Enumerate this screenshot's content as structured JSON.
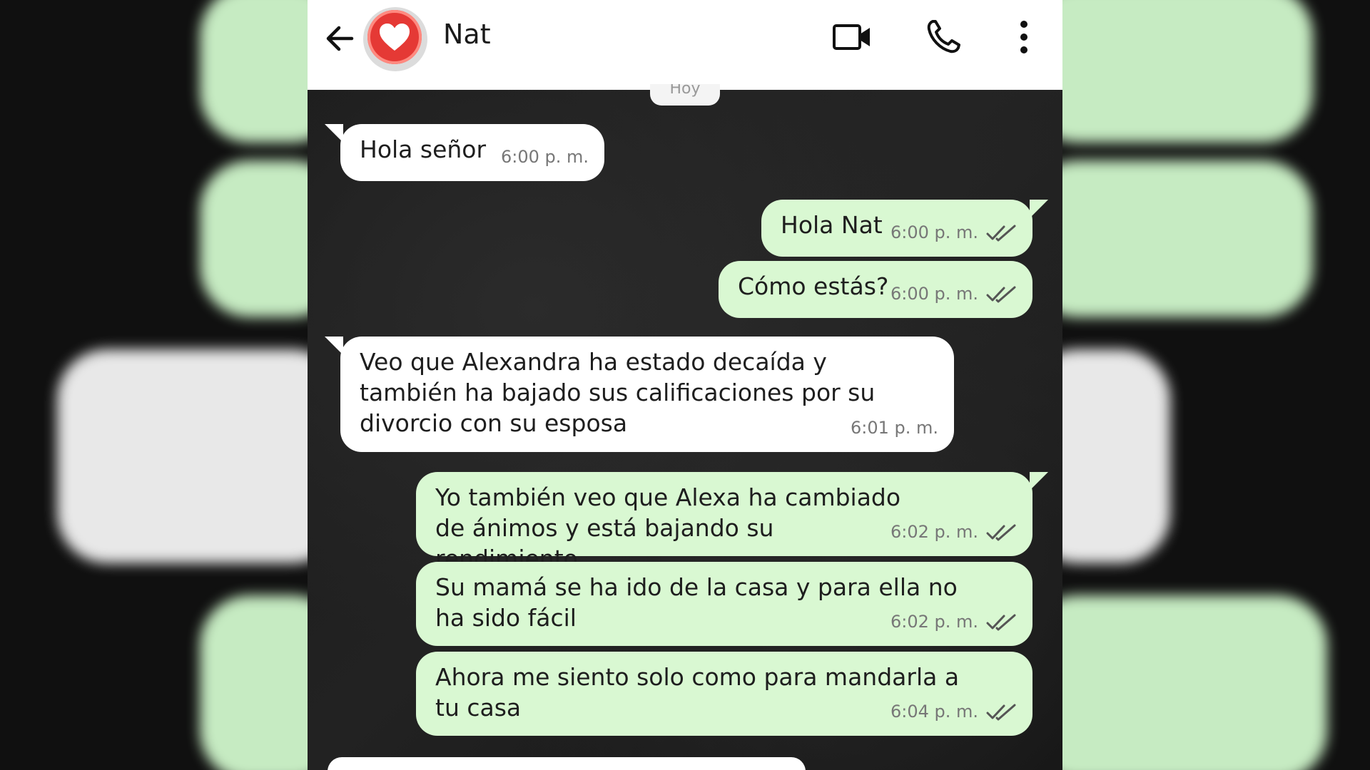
{
  "chat": {
    "contact_name": "Nat",
    "date_chip": "Hoy",
    "messages": [
      {
        "direction": "in",
        "text": "Hola señor",
        "time": "6:00 p. m."
      },
      {
        "direction": "out",
        "text": "Hola Nat",
        "time": "6:00 p. m."
      },
      {
        "direction": "out",
        "text": "Cómo estás?",
        "time": "6:00 p. m."
      },
      {
        "direction": "in",
        "text": "Veo que Alexandra ha estado decaída y también ha bajado sus calificaciones por su divorcio con su esposa",
        "time": "6:01 p. m."
      },
      {
        "direction": "out",
        "text": "Yo también veo que Alexa ha cambiado de ánimos y está bajando su rendimiento",
        "time": "6:02 p. m."
      },
      {
        "direction": "out",
        "text": "Su mamá se ha ido de la casa y para ella no ha sido fácil",
        "time": "6:02 p. m."
      },
      {
        "direction": "out",
        "text": "Ahora me siento solo como para mandarla a tu casa",
        "time": "6:04 p. m."
      }
    ]
  },
  "icons": {
    "back": "arrow-left-icon",
    "avatar": "heart-icon",
    "video": "video-camera-icon",
    "call": "phone-icon",
    "more": "more-vertical-icon",
    "read": "double-check-icon"
  },
  "colors": {
    "incoming_bubble": "#ffffff",
    "outgoing_bubble": "#d9f8d2",
    "avatar_heart": "#e53935"
  }
}
